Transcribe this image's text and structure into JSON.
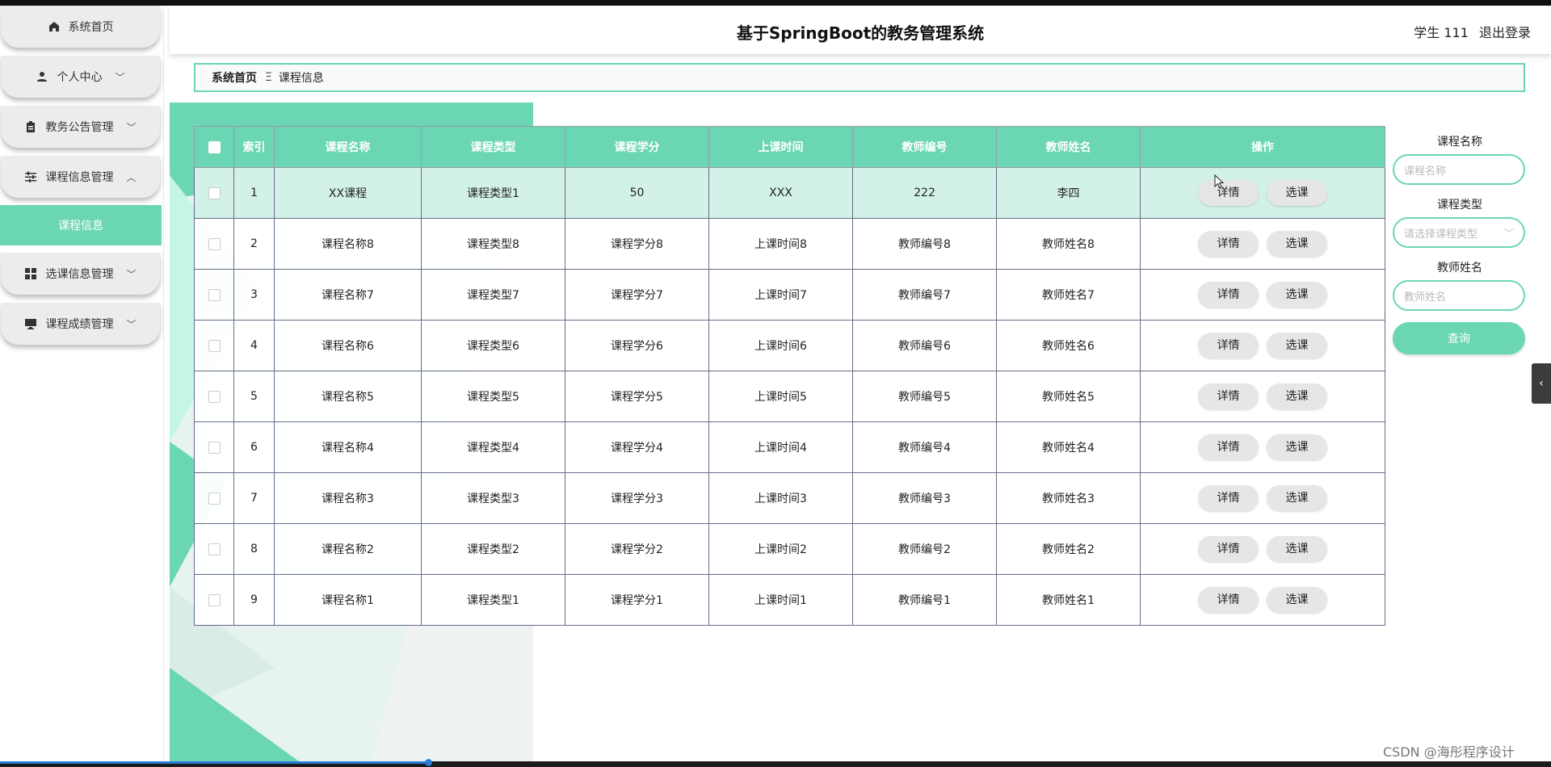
{
  "app": {
    "title": "基于SpringBoot的教务管理系统"
  },
  "user": {
    "name": "学生 111",
    "logout_label": "退出登录"
  },
  "sidebar": {
    "items": [
      {
        "label": "系统首页",
        "icon": "home-icon"
      },
      {
        "label": "个人中心",
        "icon": "person-icon"
      },
      {
        "label": "教务公告管理",
        "icon": "clipboard-icon"
      },
      {
        "label": "课程信息管理",
        "icon": "sliders-icon"
      },
      {
        "label": "选课信息管理",
        "icon": "grid-icon"
      },
      {
        "label": "课程成绩管理",
        "icon": "monitor-icon"
      }
    ],
    "sub_item": "课程信息"
  },
  "breadcrumb": {
    "home": "系统首页",
    "separator": "Ξ",
    "current": "课程信息"
  },
  "table": {
    "headers": [
      "索引",
      "课程名称",
      "课程类型",
      "课程学分",
      "上课时间",
      "教师编号",
      "教师姓名",
      "操作"
    ],
    "detail_label": "详情",
    "select_label": "选课",
    "rows": [
      {
        "index": "1",
        "name": "XX课程",
        "type": "课程类型1",
        "credit": "50",
        "time": "XXX",
        "teacher_no": "222",
        "teacher_name": "李四"
      },
      {
        "index": "2",
        "name": "课程名称8",
        "type": "课程类型8",
        "credit": "课程学分8",
        "time": "上课时间8",
        "teacher_no": "教师编号8",
        "teacher_name": "教师姓名8"
      },
      {
        "index": "3",
        "name": "课程名称7",
        "type": "课程类型7",
        "credit": "课程学分7",
        "time": "上课时间7",
        "teacher_no": "教师编号7",
        "teacher_name": "教师姓名7"
      },
      {
        "index": "4",
        "name": "课程名称6",
        "type": "课程类型6",
        "credit": "课程学分6",
        "time": "上课时间6",
        "teacher_no": "教师编号6",
        "teacher_name": "教师姓名6"
      },
      {
        "index": "5",
        "name": "课程名称5",
        "type": "课程类型5",
        "credit": "课程学分5",
        "time": "上课时间5",
        "teacher_no": "教师编号5",
        "teacher_name": "教师姓名5"
      },
      {
        "index": "6",
        "name": "课程名称4",
        "type": "课程类型4",
        "credit": "课程学分4",
        "time": "上课时间4",
        "teacher_no": "教师编号4",
        "teacher_name": "教师姓名4"
      },
      {
        "index": "7",
        "name": "课程名称3",
        "type": "课程类型3",
        "credit": "课程学分3",
        "time": "上课时间3",
        "teacher_no": "教师编号3",
        "teacher_name": "教师姓名3"
      },
      {
        "index": "8",
        "name": "课程名称2",
        "type": "课程类型2",
        "credit": "课程学分2",
        "time": "上课时间2",
        "teacher_no": "教师编号2",
        "teacher_name": "教师姓名2"
      },
      {
        "index": "9",
        "name": "课程名称1",
        "type": "课程类型1",
        "credit": "课程学分1",
        "time": "上课时间1",
        "teacher_no": "教师编号1",
        "teacher_name": "教师姓名1"
      }
    ]
  },
  "search": {
    "course_name_label": "课程名称",
    "course_name_placeholder": "课程名称",
    "course_type_label": "课程类型",
    "course_type_placeholder": "请选择课程类型",
    "teacher_name_label": "教师姓名",
    "teacher_name_placeholder": "教师姓名",
    "query_label": "查询"
  },
  "watermark": "CSDN @海彤程序设计",
  "colors": {
    "accent": "#6bd6b3",
    "highlight_row": "#d2f1e7"
  }
}
